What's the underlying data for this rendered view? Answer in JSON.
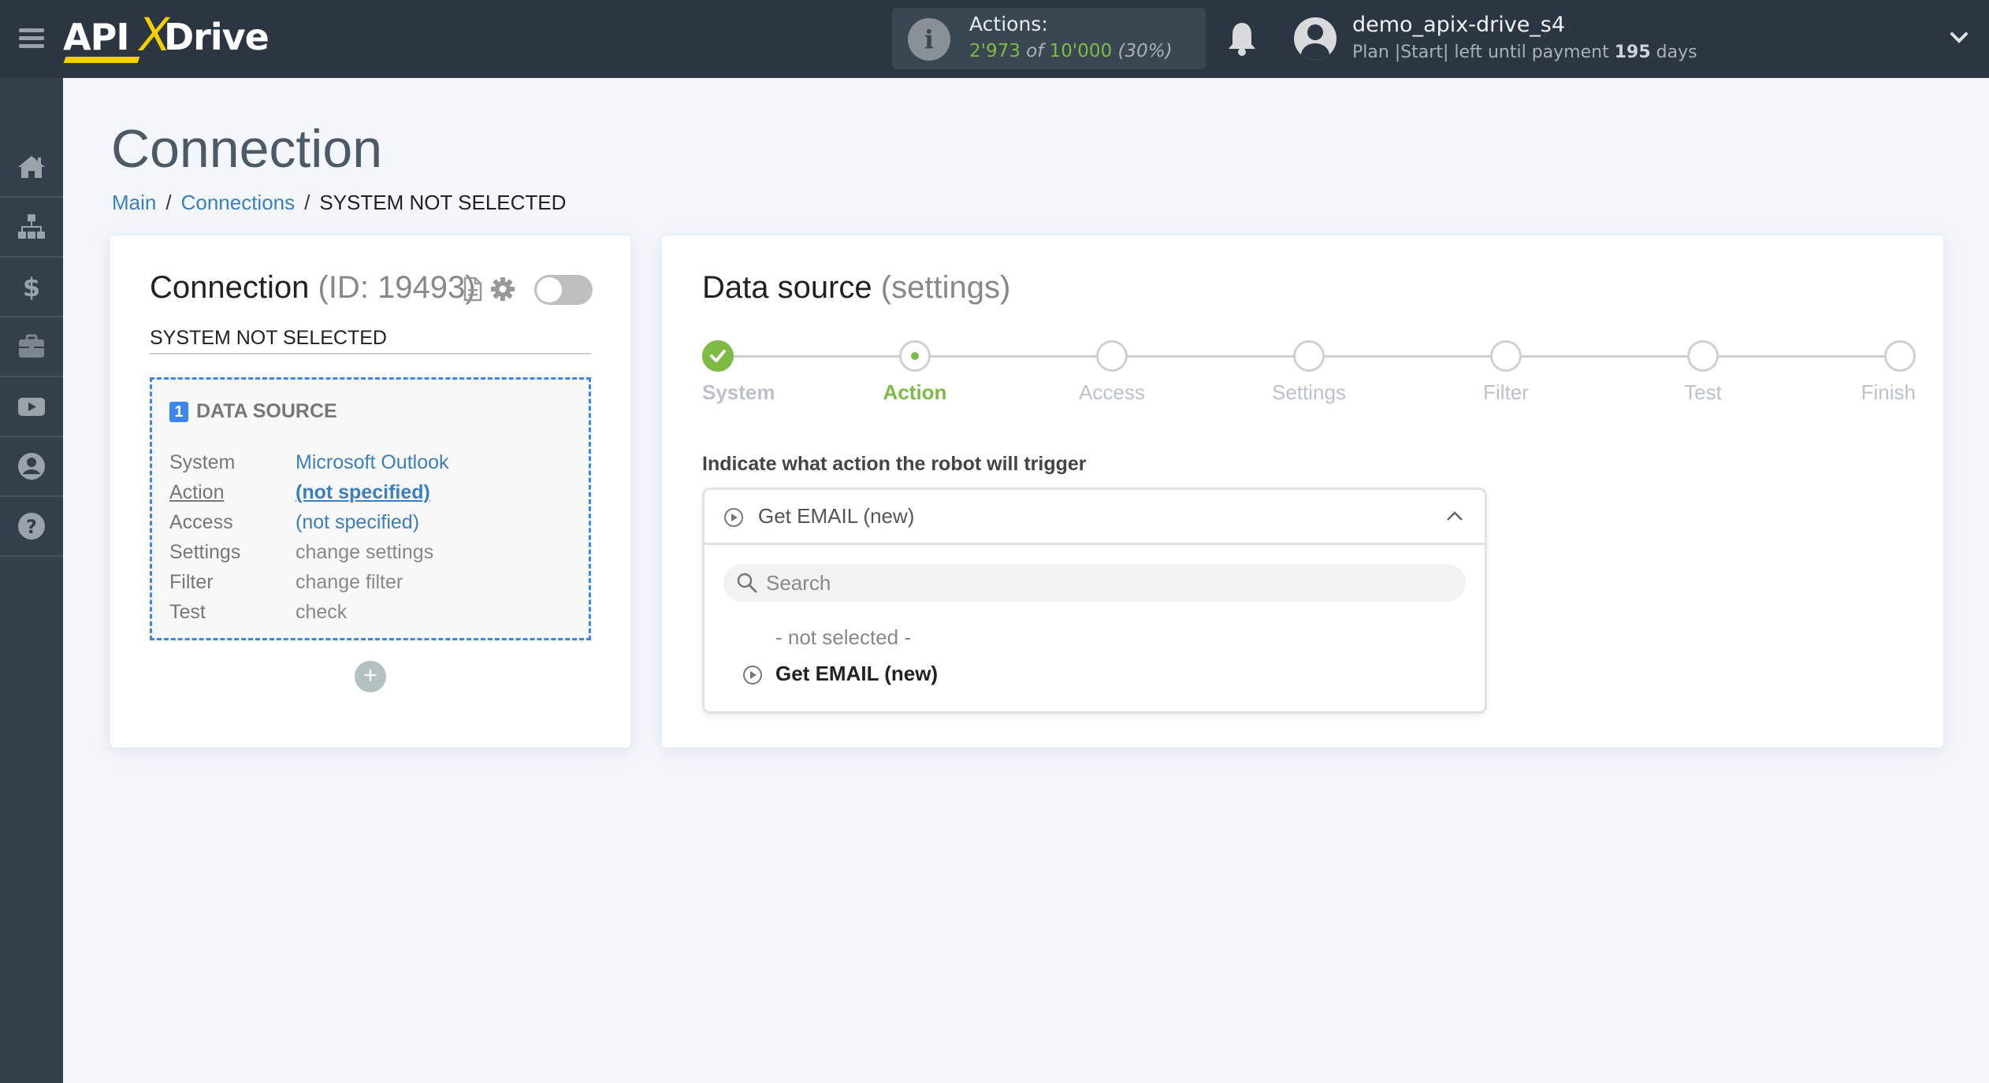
{
  "header": {
    "logo": {
      "api": "API",
      "x": "X",
      "drive": "Drive"
    },
    "actions": {
      "label": "Actions:",
      "used": "2'973",
      "of": "of",
      "total": "10'000",
      "percent": "(30%)",
      "used_fraction": 0.3
    },
    "user": {
      "name": "demo_apix-drive_s4",
      "plan_prefix": "Plan |Start| left until payment",
      "days_count": "195",
      "days_suffix": "days"
    }
  },
  "sidebar": {
    "items": [
      {
        "id": "home",
        "icon": "home-icon"
      },
      {
        "id": "connections",
        "icon": "sitemap-icon"
      },
      {
        "id": "billing",
        "icon": "dollar-icon"
      },
      {
        "id": "briefcase",
        "icon": "briefcase-icon"
      },
      {
        "id": "video",
        "icon": "youtube-icon"
      },
      {
        "id": "account",
        "icon": "user-circle-icon"
      },
      {
        "id": "help",
        "icon": "question-circle-icon"
      }
    ]
  },
  "page": {
    "title": "Connection",
    "breadcrumb": {
      "main": "Main",
      "connections": "Connections",
      "current": "SYSTEM NOT SELECTED",
      "separator": "/"
    }
  },
  "connection_panel": {
    "title": "Connection",
    "id_text": "(ID: 19493)",
    "enabled": false,
    "system_name": "SYSTEM NOT SELECTED",
    "data_source": {
      "number": "1",
      "title": "DATA SOURCE",
      "rows": [
        {
          "key": "System",
          "value": "Microsoft Outlook"
        },
        {
          "key": "Action",
          "value": "(not specified)"
        },
        {
          "key": "Access",
          "value": "(not specified)"
        },
        {
          "key": "Settings",
          "value": "change settings"
        },
        {
          "key": "Filter",
          "value": "change filter"
        },
        {
          "key": "Test",
          "value": "check"
        }
      ]
    },
    "add_label": "+"
  },
  "settings_panel": {
    "title": "Data source",
    "subtitle": "(settings)",
    "steps": [
      {
        "label": "System",
        "state": "done"
      },
      {
        "label": "Action",
        "state": "active"
      },
      {
        "label": "Access",
        "state": "pending"
      },
      {
        "label": "Settings",
        "state": "pending"
      },
      {
        "label": "Filter",
        "state": "pending"
      },
      {
        "label": "Test",
        "state": "pending"
      },
      {
        "label": "Finish",
        "state": "pending"
      }
    ],
    "field_label": "Indicate what action the robot will trigger",
    "dropdown": {
      "selected": "Get EMAIL (new)",
      "search_placeholder": "Search",
      "search_value": "",
      "options": [
        {
          "label": "- not selected -"
        },
        {
          "label": "Get EMAIL (new)"
        }
      ]
    }
  },
  "colors": {
    "header_bg": "#2c3642",
    "sidebar_bg": "#343f4c",
    "accent_green": "#7dbb45",
    "accent_blue": "#3b86f0",
    "link_blue": "#3b7fc0",
    "logo_yellow": "#f5d000"
  }
}
